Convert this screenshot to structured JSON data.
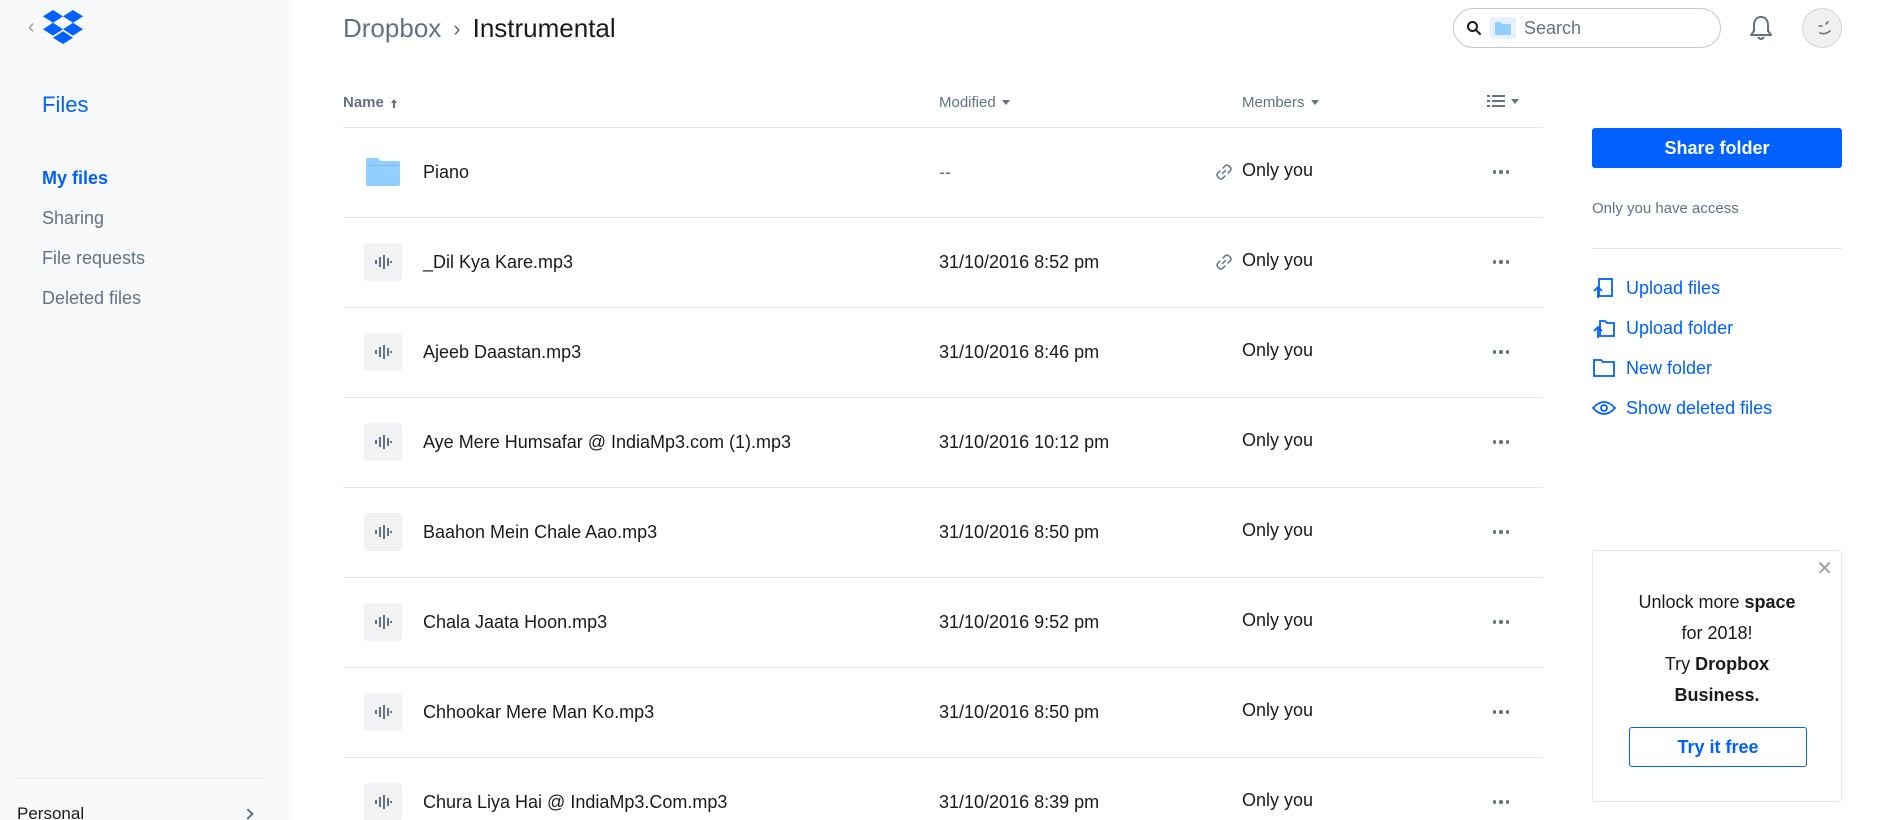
{
  "sidebar": {
    "title": "Files",
    "items": [
      {
        "label": "My files",
        "active": true
      },
      {
        "label": "Sharing"
      },
      {
        "label": "File requests"
      },
      {
        "label": "Deleted files"
      }
    ],
    "account_label": "Personal"
  },
  "header": {
    "breadcrumb_parent": "Dropbox",
    "breadcrumb_separator": "›",
    "breadcrumb_current": "Instrumental",
    "search_placeholder": "Search"
  },
  "table": {
    "columns": {
      "name": "Name",
      "modified": "Modified",
      "members": "Members"
    },
    "rows": [
      {
        "type": "folder",
        "name": "Piano",
        "modified": "--",
        "shared_link": true,
        "members": "Only you"
      },
      {
        "type": "audio",
        "name": "_Dil Kya Kare.mp3",
        "modified": "31/10/2016 8:52 pm",
        "shared_link": true,
        "members": "Only you"
      },
      {
        "type": "audio",
        "name": "Ajeeb Daastan.mp3",
        "modified": "31/10/2016 8:46 pm",
        "shared_link": false,
        "members": "Only you"
      },
      {
        "type": "audio",
        "name": "Aye Mere Humsafar @ IndiaMp3.com (1).mp3",
        "modified": "31/10/2016 10:12 pm",
        "shared_link": false,
        "members": "Only you"
      },
      {
        "type": "audio",
        "name": "Baahon Mein Chale Aao.mp3",
        "modified": "31/10/2016 8:50 pm",
        "shared_link": false,
        "members": "Only you"
      },
      {
        "type": "audio",
        "name": "Chala Jaata Hoon.mp3",
        "modified": "31/10/2016 9:52 pm",
        "shared_link": false,
        "members": "Only you"
      },
      {
        "type": "audio",
        "name": "Chhookar Mere Man Ko.mp3",
        "modified": "31/10/2016 8:50 pm",
        "shared_link": false,
        "members": "Only you"
      },
      {
        "type": "audio",
        "name": "Chura Liya Hai @ IndiaMp3.Com.mp3",
        "modified": "31/10/2016 8:39 pm",
        "shared_link": false,
        "members": "Only you"
      }
    ]
  },
  "right_panel": {
    "share_button": "Share folder",
    "access_text": "Only you have access",
    "actions": [
      {
        "label": "Upload files",
        "icon": "upload-files-icon"
      },
      {
        "label": "Upload folder",
        "icon": "upload-folder-icon"
      },
      {
        "label": "New folder",
        "icon": "new-folder-icon"
      },
      {
        "label": "Show deleted files",
        "icon": "eye-icon"
      }
    ],
    "promo": {
      "line1_pre": "Unlock more ",
      "line1_bold": "space",
      "line2": "for 2018!",
      "line3_pre": "Try ",
      "line3_bold": "Dropbox Business.",
      "button": "Try it free",
      "close": "✕"
    }
  },
  "colors": {
    "accent": "#0061fe",
    "sidebar_bg": "#f7f9fa",
    "muted_text": "#637282",
    "folder": "#92ceff"
  }
}
